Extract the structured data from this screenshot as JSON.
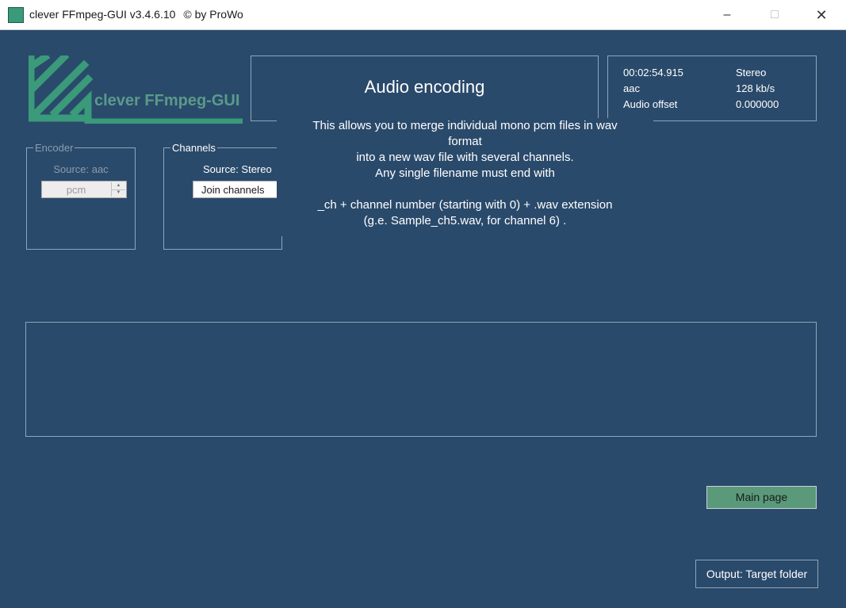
{
  "window": {
    "title": "clever FFmpeg-GUI v3.4.6.10",
    "copyright": "© by ProWo",
    "minimize_icon": "minimize-icon",
    "maximize_icon": "maximize-icon",
    "close_icon": "close-icon"
  },
  "logo": {
    "text": "clever FFmpeg-GUI",
    "color": "#3a9a7a"
  },
  "header": {
    "title": "Audio encoding"
  },
  "info": {
    "duration": "00:02:54.915",
    "channels": "Stereo",
    "codec": "aac",
    "bitrate": "128 kb/s",
    "offset_label": "Audio offset",
    "offset_value": "0.000000"
  },
  "encoder": {
    "legend": "Encoder",
    "source": "Source: aac",
    "value": "pcm"
  },
  "channels_group": {
    "legend": "Channels",
    "source": "Source: Stereo",
    "value": "Join channels"
  },
  "tooltip": {
    "lines": [
      "This allows you to merge individual mono pcm files in wav",
      "format",
      "into a new wav file with several channels.",
      "Any single filename must end with",
      "",
      "_ch + channel number (starting with 0) + .wav extension",
      "(g.e. Sample_ch5.wav, for channel 6) ."
    ]
  },
  "buttons": {
    "main_page": "Main page",
    "output": "Output: Target folder"
  },
  "colors": {
    "background": "#2a4a6b",
    "accent": "#5a9a7a",
    "border": "#8fa5bb",
    "titlebar": "#ffffff"
  }
}
